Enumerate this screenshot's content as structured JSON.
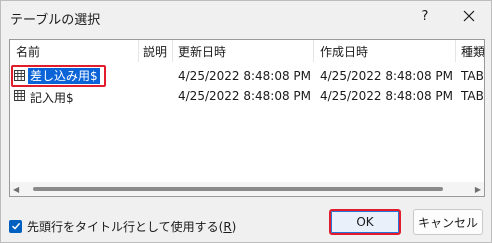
{
  "window": {
    "title": "テーブルの選択",
    "help": "?",
    "close_icon": "close-icon"
  },
  "table": {
    "columns": [
      "名前",
      "説明",
      "更新日時",
      "作成日時",
      "種類"
    ],
    "rows": [
      {
        "name": "差し込み用$",
        "description": "",
        "modified": "4/25/2022 8:48:08 PM",
        "created": "4/25/2022 8:48:08 PM",
        "type": "TAB",
        "selected": true
      },
      {
        "name": "記入用$",
        "description": "",
        "modified": "4/25/2022 8:48:08 PM",
        "created": "4/25/2022 8:48:08 PM",
        "type": "TAB",
        "selected": false
      }
    ],
    "row_icon": "table-icon"
  },
  "option": {
    "label": "先頭行をタイトル行として使用する(",
    "accesskey": "R",
    "label_end": ")",
    "checked": true
  },
  "buttons": {
    "ok": "OK",
    "cancel": "キャンセル"
  },
  "colors": {
    "accent": "#0a64d8",
    "highlight_box": "#e21c2b",
    "checkbox": "#0060c0"
  }
}
